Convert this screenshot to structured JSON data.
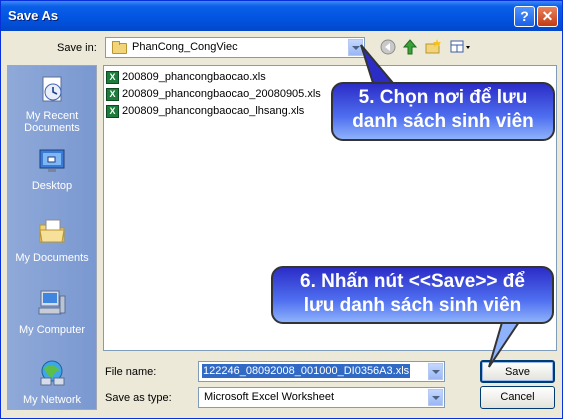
{
  "window": {
    "title": "Save As",
    "help_glyph": "?",
    "close_glyph": "✕"
  },
  "save_in": {
    "label": "Save in:",
    "value": "PhanCong_CongViec"
  },
  "places": [
    {
      "name": "my-recent-documents",
      "line1": "My Recent",
      "line2": "Documents",
      "icon": "recent-documents-icon"
    },
    {
      "name": "desktop",
      "line1": "Desktop",
      "line2": "",
      "icon": "desktop-icon"
    },
    {
      "name": "my-documents",
      "line1": "My Documents",
      "line2": "",
      "icon": "my-documents-icon"
    },
    {
      "name": "my-computer",
      "line1": "My Computer",
      "line2": "",
      "icon": "my-computer-icon"
    },
    {
      "name": "my-network",
      "line1": "My Network",
      "line2": "",
      "icon": "my-network-icon"
    }
  ],
  "files": [
    "200809_phancongbaocao.xls",
    "200809_phancongbaocao_20080905.xls",
    "200809_phancongbaocao_lhsang.xls"
  ],
  "file_name": {
    "label": "File name:",
    "value": "122246_08092008_001000_DI0356A3.xls"
  },
  "save_as_type": {
    "label": "Save as type:",
    "value": "Microsoft Excel Worksheet"
  },
  "buttons": {
    "save": "Save",
    "cancel": "Cancel"
  },
  "callouts": {
    "first": {
      "line1": "5. Chọn nơi để lưu",
      "line2": "danh sách sinh viên"
    },
    "second": {
      "line1": "6. Nhấn nút <<Save>> để",
      "line2": "lưu danh sách sinh viên"
    }
  },
  "colors": {
    "title_bar": "#0254e0",
    "callout": "#4f6ff0",
    "selection": "#316ac5"
  }
}
